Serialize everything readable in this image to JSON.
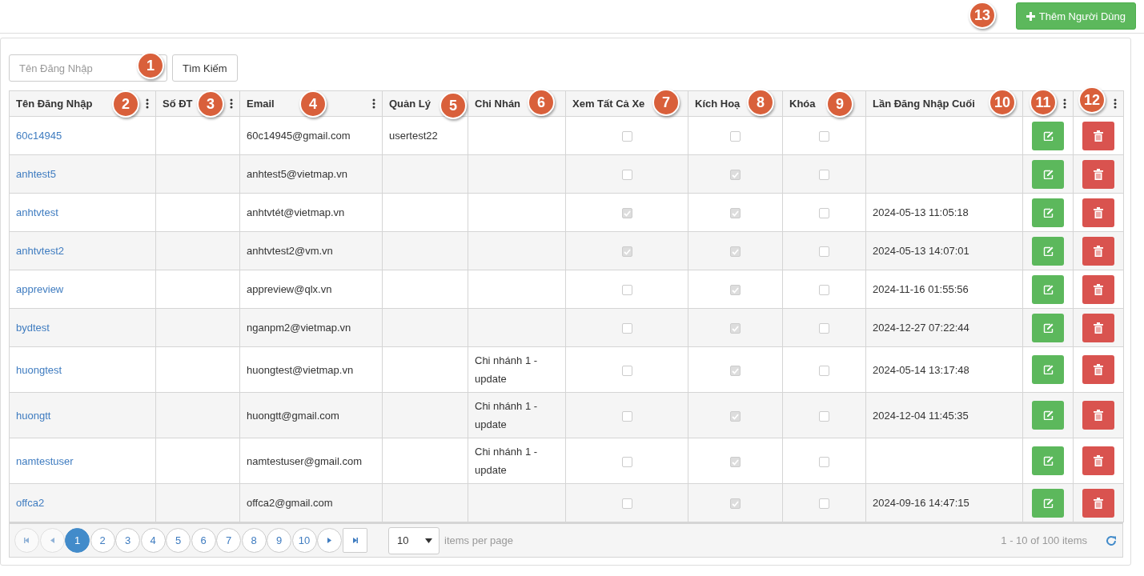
{
  "toolbar": {
    "add_button": {
      "label": "Thêm Người Dùng"
    }
  },
  "search": {
    "placeholder": "Tên Đăng Nhập",
    "button": "Tìm Kiếm"
  },
  "table": {
    "columns": [
      {
        "label": "Tên Đăng Nhập",
        "menu": true
      },
      {
        "label": "Số ĐT",
        "menu": true
      },
      {
        "label": "Email",
        "menu": true
      },
      {
        "label": "Quản Lý",
        "menu": false
      },
      {
        "label": "Chi Nhán",
        "menu": false
      },
      {
        "label": "Xem Tất Cả Xe",
        "menu": false
      },
      {
        "label": "Kích Hoạ",
        "menu": false
      },
      {
        "label": "Khóa",
        "menu": false
      },
      {
        "label": "Lần Đăng Nhập Cuối",
        "menu": false
      },
      {
        "menu": true
      },
      {
        "menu": true
      }
    ],
    "rows": [
      {
        "username": "60c14945",
        "email": "60c14945@gmail.com",
        "manager": "usertest22",
        "view_all": false,
        "active": false,
        "locked": false
      },
      {
        "username": "anhtest5",
        "email": "anhtest5@vietmap.vn",
        "view_all": false,
        "active": true,
        "locked": false
      },
      {
        "username": "anhtvtest",
        "email": "anhtvtét@vietmap.vn",
        "view_all": true,
        "active": true,
        "locked": false,
        "last_login": "2024-05-13 11:05:18"
      },
      {
        "username": "anhtvtest2",
        "email": "anhtvtest2@vm.vn",
        "view_all": true,
        "active": true,
        "locked": false,
        "last_login": "2024-05-13 14:07:01"
      },
      {
        "username": "appreview",
        "email": "appreview@qlx.vn",
        "view_all": false,
        "active": true,
        "locked": false,
        "last_login": "2024-11-16 01:55:56"
      },
      {
        "username": "bydtest",
        "email": "nganpm2@vietmap.vn",
        "view_all": false,
        "active": true,
        "locked": false,
        "last_login": "2024-12-27 07:22:44"
      },
      {
        "username": "huongtest",
        "email": "huongtest@vietmap.vn",
        "branch": "Chi nhánh 1 - update",
        "view_all": false,
        "active": true,
        "locked": false,
        "last_login": "2024-05-14 13:17:48"
      },
      {
        "username": "huongtt",
        "email": "huongtt@gmail.com",
        "branch": "Chi nhánh 1 - update",
        "view_all": false,
        "active": true,
        "locked": false,
        "last_login": "2024-12-04 11:45:35"
      },
      {
        "username": "namtestuser",
        "email": "namtestuser@gmail.com",
        "branch": "Chi nhánh 1 - update",
        "view_all": false,
        "active": true,
        "locked": false
      },
      {
        "username": "offca2",
        "email": "offca2@gmail.com",
        "view_all": false,
        "active": true,
        "locked": false,
        "last_login": "2024-09-16 14:47:15"
      }
    ]
  },
  "pager": {
    "first_disabled": true,
    "prev_disabled": true,
    "pages": [
      {
        "label": "1",
        "selected": true
      },
      {
        "label": "2",
        "selected": false
      },
      {
        "label": "3",
        "selected": false
      },
      {
        "label": "4",
        "selected": false
      },
      {
        "label": "5",
        "selected": false
      },
      {
        "label": "6",
        "selected": false
      },
      {
        "label": "7",
        "selected": false
      },
      {
        "label": "8",
        "selected": false
      },
      {
        "label": "9",
        "selected": false
      },
      {
        "label": "10",
        "selected": false
      }
    ],
    "page_size": "10",
    "page_size_label": "items per page",
    "summary": "1 - 10 of 100 items"
  },
  "callouts": [
    "1",
    "2",
    "3",
    "4",
    "5",
    "6",
    "7",
    "8",
    "9",
    "10",
    "11",
    "12",
    "13"
  ]
}
